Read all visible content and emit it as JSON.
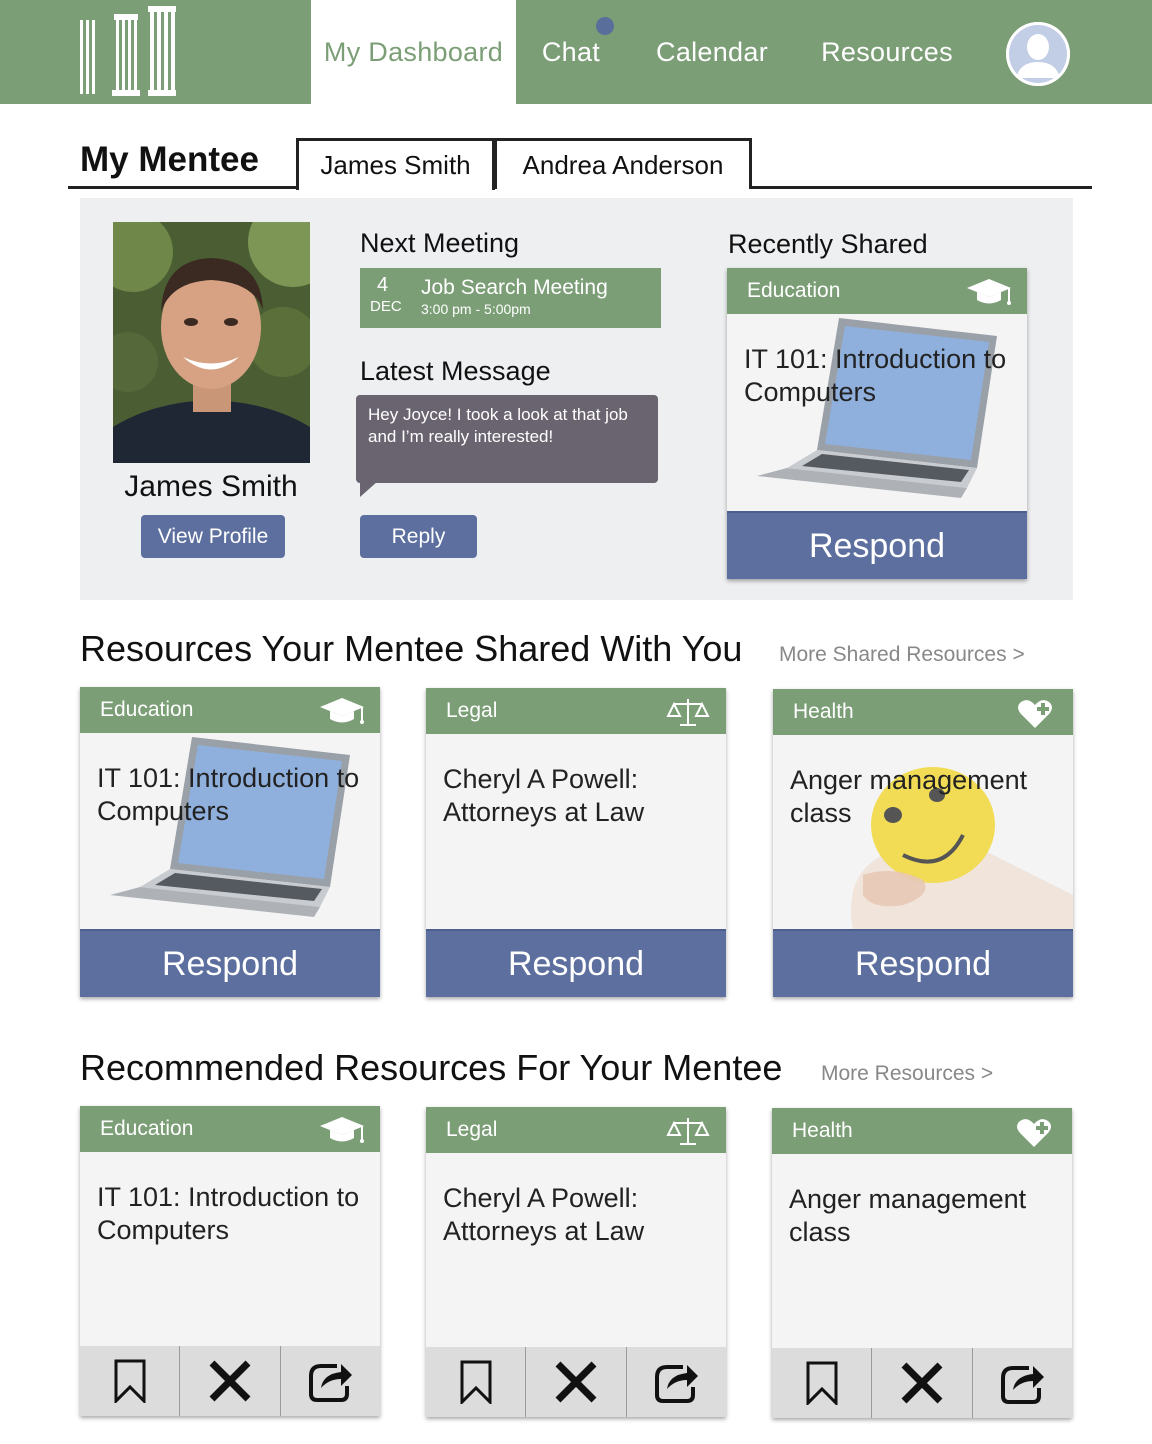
{
  "nav": {
    "items": [
      {
        "label": "My Dashboard",
        "active": true
      },
      {
        "label": "Chat",
        "active": false
      },
      {
        "label": "Calendar",
        "active": false
      },
      {
        "label": "Resources",
        "active": false
      }
    ],
    "chat_unread_dot": true,
    "accent_color": "#7b9e76"
  },
  "mentee": {
    "section_title": "My Mentee",
    "tabs": [
      {
        "label": "James Smith",
        "active": true
      },
      {
        "label": "Andrea Anderson",
        "active": false
      }
    ],
    "name": "James Smith",
    "view_profile_label": "View Profile",
    "next_meeting": {
      "heading": "Next Meeting",
      "day": "4",
      "month": "DEC",
      "title": "Job Search Meeting",
      "time": "3:00 pm - 5:00pm"
    },
    "latest_message": {
      "heading": "Latest Message",
      "text": "Hey Joyce! I took a look at that job and I’m really interested!",
      "reply_label": "Reply"
    },
    "recently_shared": {
      "heading": "Recently Shared",
      "category": "Education",
      "icon": "graduation-cap-icon",
      "title": "IT 101: Introduction to Computers",
      "action_label": "Respond"
    }
  },
  "shared": {
    "heading": "Resources Your Mentee Shared With You",
    "more_label": "More Shared Resources >",
    "cards": [
      {
        "category": "Education",
        "icon": "graduation-cap-icon",
        "title": "IT 101: Introduction to Computers",
        "action_label": "Respond"
      },
      {
        "category": "Legal",
        "icon": "scales-icon",
        "title": "Cheryl A Powell: Attorneys at Law",
        "action_label": "Respond"
      },
      {
        "category": "Health",
        "icon": "heart-plus-icon",
        "title": "Anger management class",
        "action_label": "Respond"
      }
    ]
  },
  "recommended": {
    "heading": "Recommended Resources For Your Mentee",
    "more_label": "More Resources >",
    "cards": [
      {
        "category": "Education",
        "icon": "graduation-cap-icon",
        "title": "IT 101: Introduction to Computers"
      },
      {
        "category": "Legal",
        "icon": "scales-icon",
        "title": "Cheryl A Powell: Attorneys at Law"
      },
      {
        "category": "Health",
        "icon": "heart-plus-icon",
        "title": "Anger management class"
      }
    ]
  },
  "colors": {
    "green": "#7b9e76",
    "blue": "#5c6f9e",
    "message": "#6a6470",
    "panel": "#eeeff1"
  }
}
